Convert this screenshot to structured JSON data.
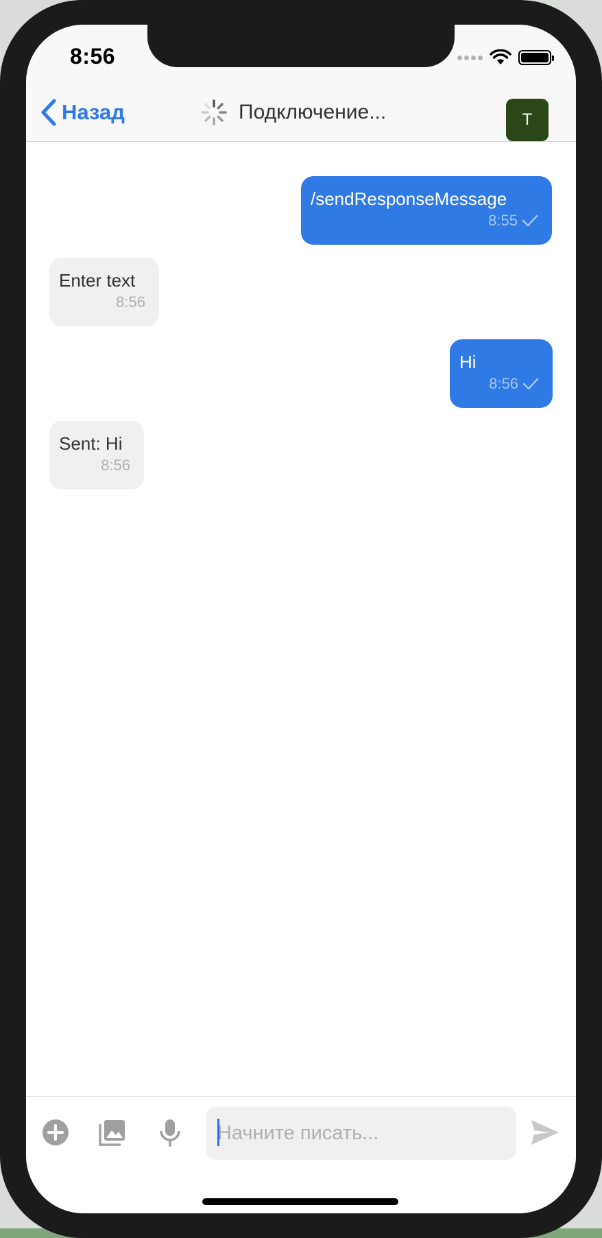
{
  "status_bar": {
    "time": "8:56"
  },
  "nav": {
    "back_label": "Назад",
    "title": "Подключение...",
    "avatar_initial": "T"
  },
  "messages": [
    {
      "direction": "out",
      "text": "/sendResponseMessage",
      "time": "8:55",
      "delivered": true
    },
    {
      "direction": "in",
      "text": "Enter text",
      "time": "8:56"
    },
    {
      "direction": "out",
      "text": "Hi",
      "time": "8:56",
      "delivered": true
    },
    {
      "direction": "in",
      "text": "Sent: Hi",
      "time": "8:56"
    }
  ],
  "composer": {
    "placeholder": "Начните писать...",
    "value": ""
  },
  "icons": {
    "back": "chevron-left-icon",
    "loading": "spinner-icon",
    "add": "plus-circle-icon",
    "gallery": "image-icon",
    "microphone": "microphone-icon",
    "send": "send-icon"
  },
  "colors": {
    "accent": "#2f7ae5",
    "incoming_bubble": "#f0f0f0",
    "avatar": "#2b4717"
  }
}
